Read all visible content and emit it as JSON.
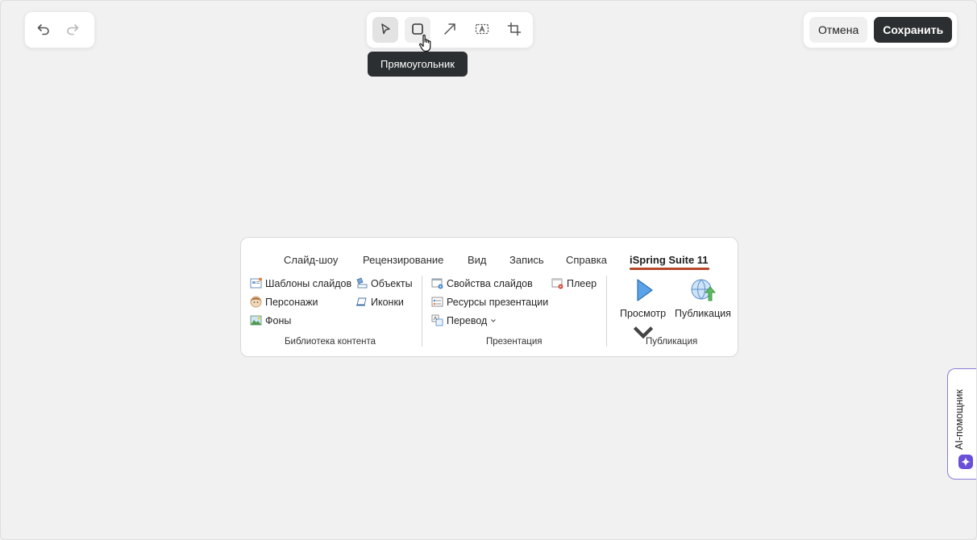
{
  "toolbar": {
    "undo_icon": "undo-icon",
    "redo_icon": "redo-icon",
    "tools": [
      {
        "name": "select",
        "icon": "cursor-pointer-icon"
      },
      {
        "name": "rectangle",
        "icon": "rectangle-icon"
      },
      {
        "name": "arrow",
        "icon": "arrow-icon"
      },
      {
        "name": "text",
        "icon": "text-box-icon"
      },
      {
        "name": "crop",
        "icon": "crop-icon"
      }
    ],
    "tooltip": "Прямоугольник",
    "cancel_label": "Отмена",
    "save_label": "Сохранить"
  },
  "ribbon": {
    "tabs": [
      "Слайд-шоу",
      "Рецензирование",
      "Вид",
      "Запись",
      "Справка",
      "iSpring Suite 11"
    ],
    "active_tab": "iSpring Suite 11",
    "content_library": {
      "items": [
        "Шаблоны слайдов",
        "Объекты",
        "Персонажи",
        "Иконки",
        "Фоны"
      ],
      "label": "Библиотека контента"
    },
    "presentation": {
      "items": [
        "Свойства слайдов",
        "Плеер",
        "Ресурсы презентации",
        "Перевод"
      ],
      "label": "Презентация"
    },
    "publishing": {
      "items": [
        "Просмотр",
        "Публикация"
      ],
      "label": "Публикация"
    }
  },
  "ai_helper": {
    "label": "AI-помощник"
  },
  "colors": {
    "background": "#f1f1f1",
    "save_button": "#2c2f31",
    "tab_underline": "#b7472a",
    "ai_accent": "#6a4fd8"
  }
}
